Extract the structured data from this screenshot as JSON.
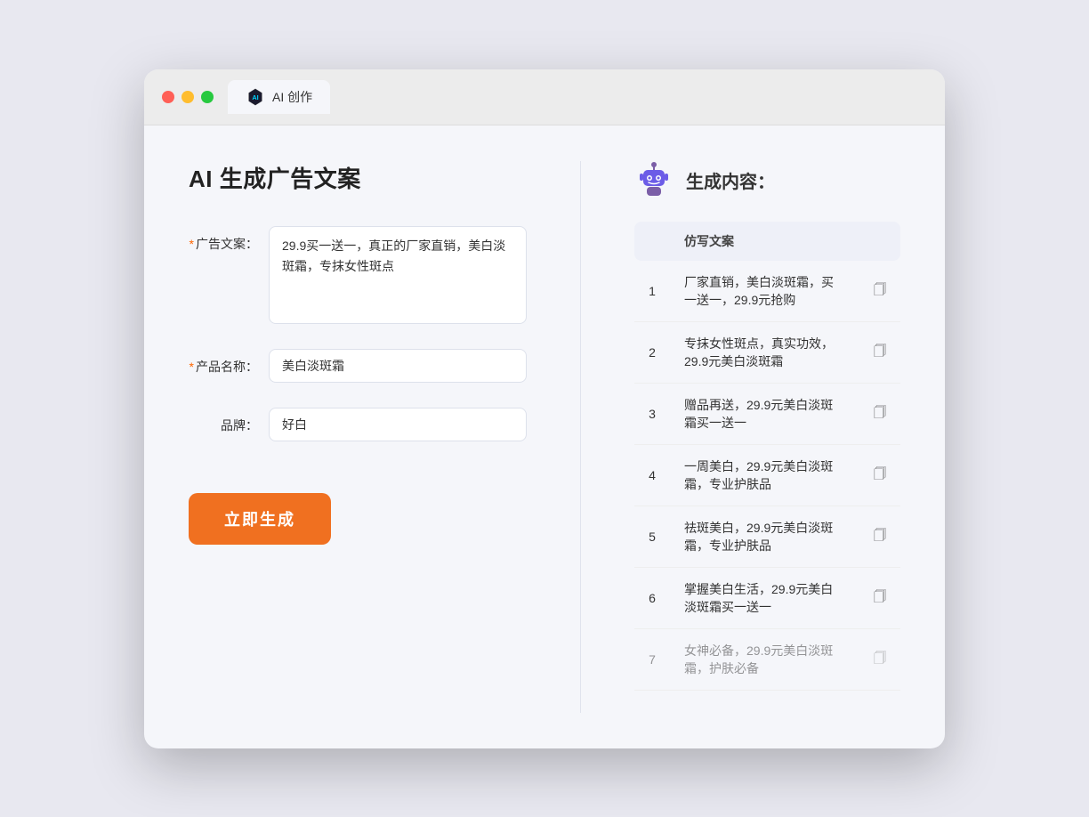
{
  "window": {
    "tab_label": "AI 创作"
  },
  "left_panel": {
    "title": "AI 生成广告文案",
    "form": {
      "ad_text_label": "广告文案：",
      "ad_text_required": true,
      "ad_text_value": "29.9买一送一，真正的厂家直销，美白淡斑霜，专抹女性斑点",
      "product_name_label": "产品名称：",
      "product_name_required": true,
      "product_name_value": "美白淡斑霜",
      "brand_label": "品牌：",
      "brand_required": false,
      "brand_value": "好白",
      "generate_btn_label": "立即生成"
    }
  },
  "right_panel": {
    "title": "生成内容：",
    "column_header": "仿写文案",
    "results": [
      {
        "num": 1,
        "text": "厂家直销，美白淡斑霜，买一送一，29.9元抢购"
      },
      {
        "num": 2,
        "text": "专抹女性斑点，真实功效，29.9元美白淡斑霜"
      },
      {
        "num": 3,
        "text": "赠品再送，29.9元美白淡斑霜买一送一"
      },
      {
        "num": 4,
        "text": "一周美白，29.9元美白淡斑霜，专业护肤品"
      },
      {
        "num": 5,
        "text": "祛斑美白，29.9元美白淡斑霜，专业护肤品"
      },
      {
        "num": 6,
        "text": "掌握美白生活，29.9元美白淡斑霜买一送一"
      },
      {
        "num": 7,
        "text": "女神必备，29.9元美白淡斑霜，护肤必备"
      }
    ]
  }
}
